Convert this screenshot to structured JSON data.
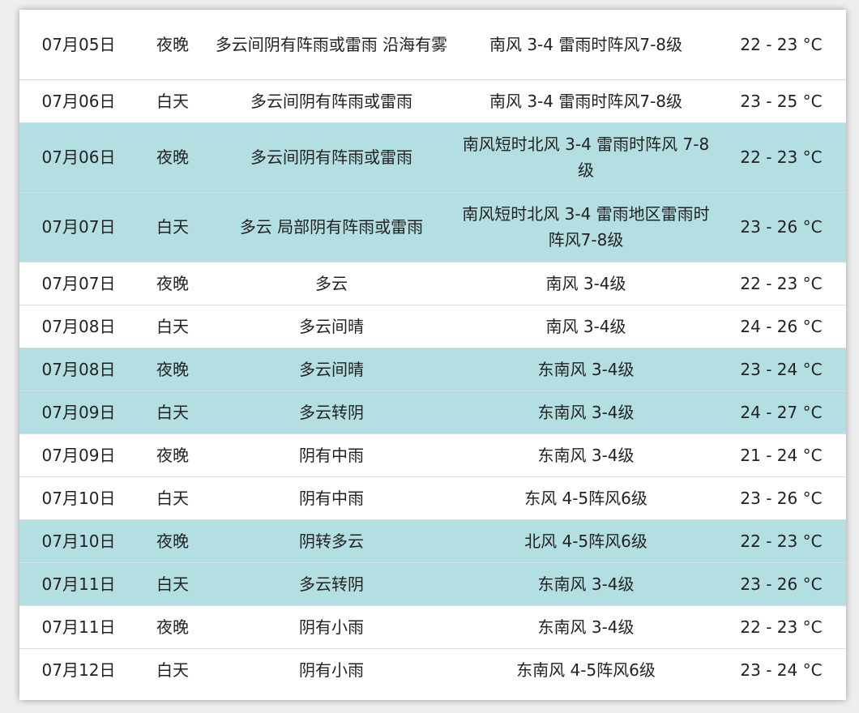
{
  "colors": {
    "highlight_row": "#b3dfe3",
    "plain_row": "#ffffff",
    "row_divider": "#dddddd"
  },
  "forecast": {
    "rows": [
      {
        "date": "07月05日",
        "period": "夜晚",
        "weather": "多云间阴有阵雨或雷雨 沿海有雾",
        "wind": "南风 3-4 雷雨时阵风7-8级",
        "temp": "22 - 23 °C",
        "highlight": false
      },
      {
        "date": "07月06日",
        "period": "白天",
        "weather": "多云间阴有阵雨或雷雨",
        "wind": "南风 3-4 雷雨时阵风7-8级",
        "temp": "23 - 25 °C",
        "highlight": false
      },
      {
        "date": "07月06日",
        "period": "夜晚",
        "weather": "多云间阴有阵雨或雷雨",
        "wind": "南风短时北风 3-4 雷雨时阵风 7-8级",
        "temp": "22 - 23 °C",
        "highlight": true
      },
      {
        "date": "07月07日",
        "period": "白天",
        "weather": "多云 局部阴有阵雨或雷雨",
        "wind": "南风短时北风 3-4 雷雨地区雷雨时阵风7-8级",
        "temp": "23 - 26 °C",
        "highlight": true
      },
      {
        "date": "07月07日",
        "period": "夜晚",
        "weather": "多云",
        "wind": "南风 3-4级",
        "temp": "22 - 23 °C",
        "highlight": false
      },
      {
        "date": "07月08日",
        "period": "白天",
        "weather": "多云间晴",
        "wind": "南风 3-4级",
        "temp": "24 - 26 °C",
        "highlight": false
      },
      {
        "date": "07月08日",
        "period": "夜晚",
        "weather": "多云间晴",
        "wind": "东南风 3-4级",
        "temp": "23 - 24 °C",
        "highlight": true
      },
      {
        "date": "07月09日",
        "period": "白天",
        "weather": "多云转阴",
        "wind": "东南风 3-4级",
        "temp": "24 - 27 °C",
        "highlight": true
      },
      {
        "date": "07月09日",
        "period": "夜晚",
        "weather": "阴有中雨",
        "wind": "东南风 3-4级",
        "temp": "21 - 24 °C",
        "highlight": false
      },
      {
        "date": "07月10日",
        "period": "白天",
        "weather": "阴有中雨",
        "wind": "东风 4-5阵风6级",
        "temp": "23 - 26 °C",
        "highlight": false
      },
      {
        "date": "07月10日",
        "period": "夜晚",
        "weather": "阴转多云",
        "wind": "北风 4-5阵风6级",
        "temp": "22 - 23 °C",
        "highlight": true
      },
      {
        "date": "07月11日",
        "period": "白天",
        "weather": "多云转阴",
        "wind": "东南风 3-4级",
        "temp": "23 - 26 °C",
        "highlight": true
      },
      {
        "date": "07月11日",
        "period": "夜晚",
        "weather": "阴有小雨",
        "wind": "东南风 3-4级",
        "temp": "22 - 23 °C",
        "highlight": false
      },
      {
        "date": "07月12日",
        "period": "白天",
        "weather": "阴有小雨",
        "wind": "东南风 4-5阵风6级",
        "temp": "23 - 24 °C",
        "highlight": false
      }
    ]
  }
}
